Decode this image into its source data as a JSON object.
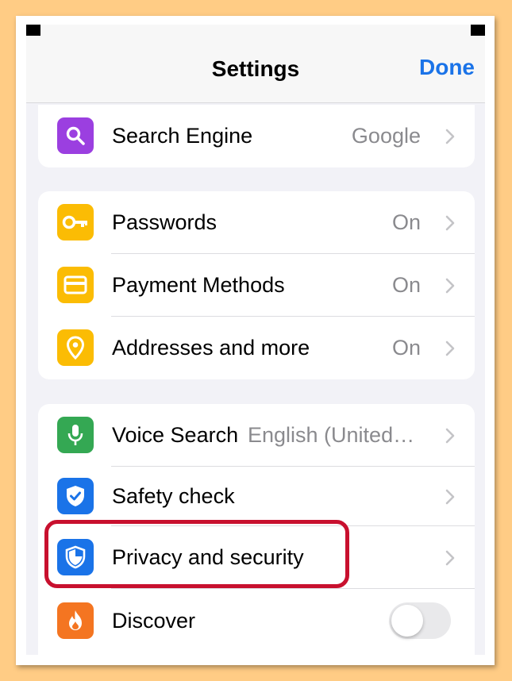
{
  "header": {
    "title": "Settings",
    "done_label": "Done"
  },
  "groups": [
    {
      "items": [
        {
          "label": "Search Engine",
          "value": "Google",
          "icon": "search-icon",
          "color": "#9B3FE0"
        }
      ]
    },
    {
      "items": [
        {
          "label": "Passwords",
          "value": "On",
          "icon": "key-icon",
          "color": "#FBBC04"
        },
        {
          "label": "Payment Methods",
          "value": "On",
          "icon": "credit-card-icon",
          "color": "#FBBC04"
        },
        {
          "label": "Addresses and more",
          "value": "On",
          "icon": "location-pin-icon",
          "color": "#FBBC04"
        }
      ]
    },
    {
      "items": [
        {
          "label": "Voice Search",
          "value": "English (United…",
          "icon": "microphone-icon",
          "color": "#34A853"
        },
        {
          "label": "Safety check",
          "value": "",
          "icon": "shield-check-icon",
          "color": "#1A73E8"
        },
        {
          "label": "Privacy and security",
          "value": "",
          "icon": "shield-half-icon",
          "color": "#1A73E8",
          "highlighted": true
        },
        {
          "label": "Discover",
          "toggle": false,
          "icon": "flame-icon",
          "color": "#F47521"
        }
      ]
    }
  ],
  "colors": {
    "accent": "#1A73E8",
    "highlight": "#C8102E"
  }
}
